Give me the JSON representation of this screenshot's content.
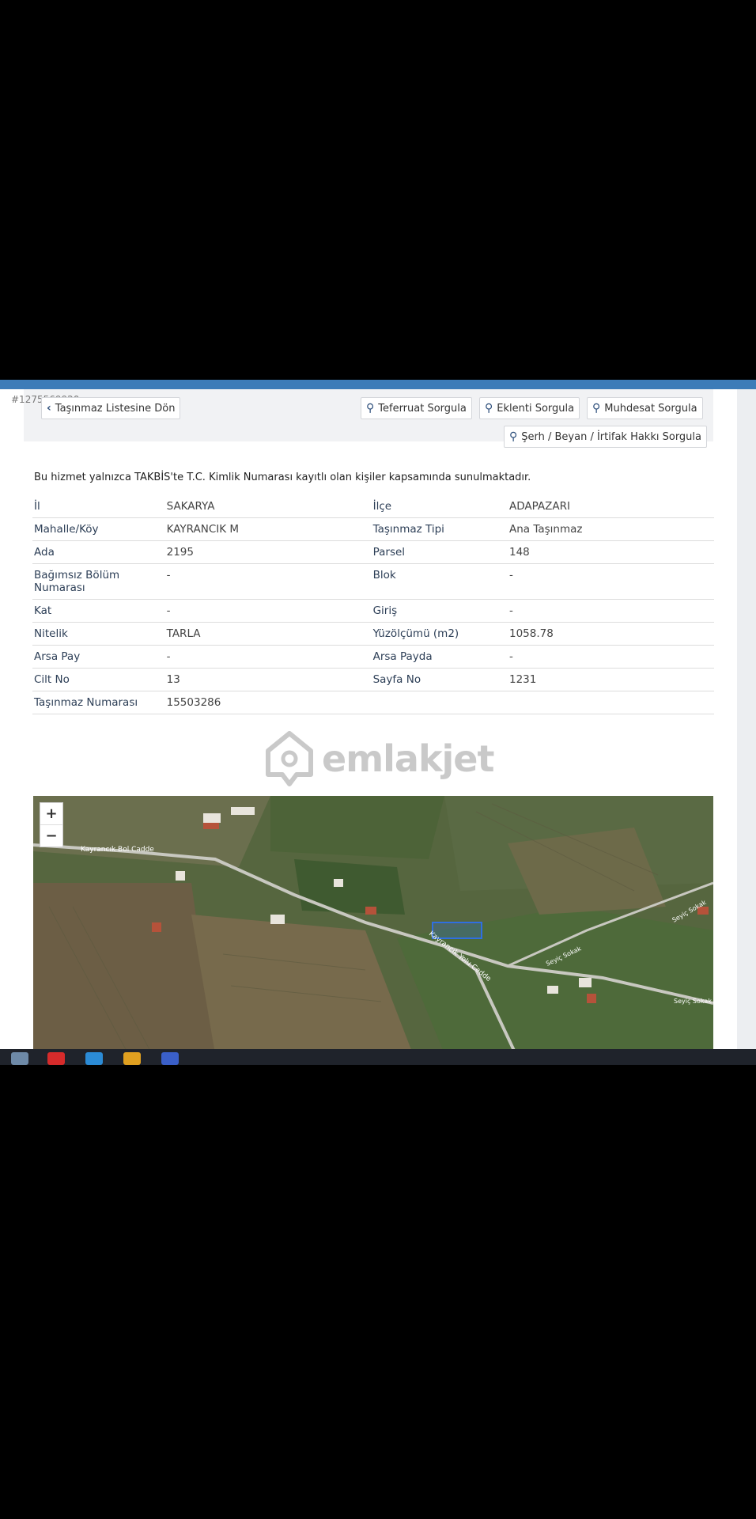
{
  "listing_id": "#1275569920",
  "toolbar": {
    "back_label": "Taşınmaz Listesine Dön",
    "teferruat_label": "Teferruat Sorgula",
    "eklenti_label": "Eklenti Sorgula",
    "muhdesat_label": "Muhdesat Sorgula",
    "serh_label": "Şerh / Beyan / İrtifak Hakkı Sorgula"
  },
  "notice": "Bu hizmet yalnızca TAKBİS'te T.C. Kimlik Numarası kayıtlı olan kişiler kapsamında sunulmaktadır.",
  "rows": [
    {
      "l1": "İl",
      "v1": "SAKARYA",
      "l2": "İlçe",
      "v2": "ADAPAZARI"
    },
    {
      "l1": "Mahalle/Köy",
      "v1": "KAYRANCIK M",
      "l2": "Taşınmaz Tipi",
      "v2": "Ana Taşınmaz"
    },
    {
      "l1": "Ada",
      "v1": "2195",
      "l2": "Parsel",
      "v2": "148"
    },
    {
      "l1": "Bağımsız Bölüm Numarası",
      "v1": "-",
      "l2": "Blok",
      "v2": "-"
    },
    {
      "l1": "Kat",
      "v1": "-",
      "l2": "Giriş",
      "v2": "-"
    },
    {
      "l1": "Nitelik",
      "v1": "TARLA",
      "l2": "Yüzölçümü (m2)",
      "v2": "1058.78"
    },
    {
      "l1": "Arsa Pay",
      "v1": "-",
      "l2": "Arsa Payda",
      "v2": "-"
    },
    {
      "l1": "Cilt No",
      "v1": "13",
      "l2": "Sayfa No",
      "v2": "1231"
    },
    {
      "l1": "Taşınmaz Numarası",
      "v1": "15503286",
      "l2": "",
      "v2": ""
    }
  ],
  "map": {
    "zoom_in": "+",
    "zoom_out": "−",
    "street_1": "Kayrancık Bol Cadde",
    "street_2": "Kayrancık Yolu Cadde",
    "street_3": "Seyiç Sokak",
    "street_4": "Seyiç Sokak",
    "street_5": "Seyiç Sokak"
  },
  "watermark": "emlakjet",
  "colors": {
    "accent_bar": "#3d7cb8",
    "highlight": "#2f6fe0"
  }
}
